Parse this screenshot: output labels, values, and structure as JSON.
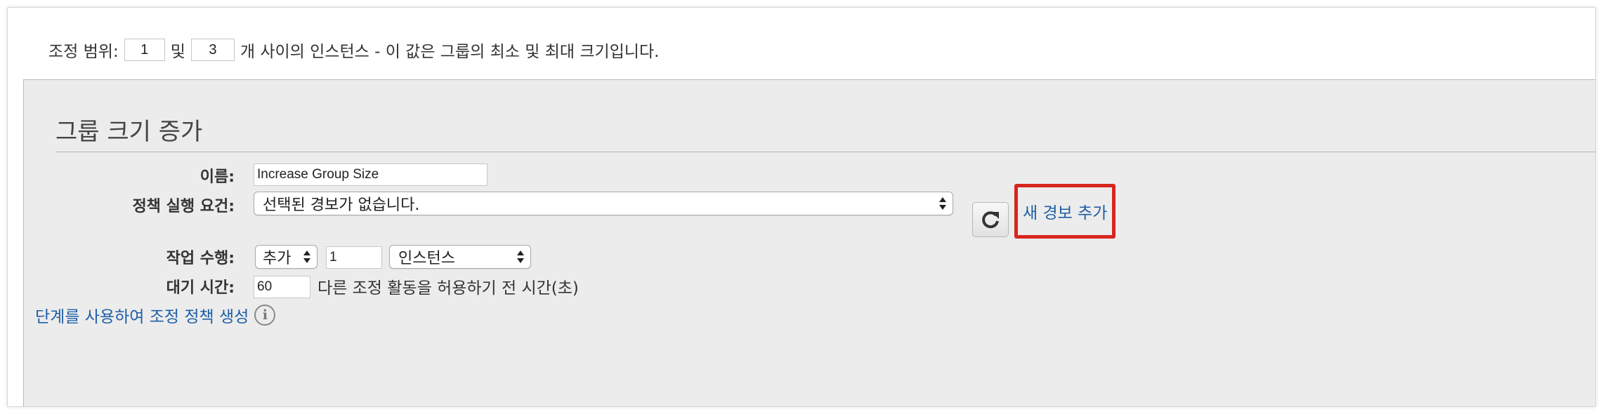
{
  "range": {
    "prefix": "조정 범위:",
    "min_value": "1",
    "and_text": "및",
    "max_value": "3",
    "suffix": "개 사이의 인스턴스 - 이 값은 그룹의 최소 및 최대 크기입니다."
  },
  "policy": {
    "title": "그룹 크기 증가",
    "name_label": "이름:",
    "name_value": "Increase Group Size",
    "execute_label": "정책 실행 요건:",
    "alarm_select_value": "선택된 경보가 없습니다.",
    "add_alarm_link": "새 경보 추가",
    "action_label": "작업 수행:",
    "action_select_value": "추가",
    "action_amount": "1",
    "unit_select_value": "인스턴스",
    "cooldown_label": "대기 시간:",
    "cooldown_value": "60",
    "cooldown_hint": "다른 조정 활동을 허용하기 전 시간(초)"
  },
  "steps_link": "단계를 사용하여 조정 정책 생성",
  "icons": {
    "refresh": "refresh-icon",
    "info": "info-icon",
    "select_arrows": "select-arrows-icon"
  },
  "colors": {
    "link": "#1f5fa6",
    "highlight": "#d7261e",
    "panel_bg": "#ececec"
  }
}
